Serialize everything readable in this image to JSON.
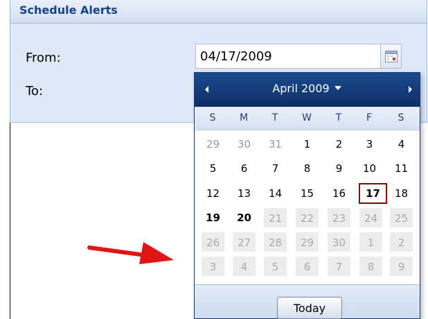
{
  "panel": {
    "title": "Schedule Alerts",
    "from_label": "From:",
    "to_label": "To:",
    "from_value": "04/17/2009"
  },
  "picker": {
    "month_label": "April 2009",
    "weekdays": [
      "S",
      "M",
      "T",
      "W",
      "T",
      "F",
      "S"
    ],
    "weeks": [
      [
        "29",
        "30",
        "31",
        "1",
        "2",
        "3",
        "4"
      ],
      [
        "5",
        "6",
        "7",
        "8",
        "9",
        "10",
        "11"
      ],
      [
        "12",
        "13",
        "14",
        "15",
        "16",
        "17",
        "18"
      ],
      [
        "19",
        "20",
        "21",
        "22",
        "23",
        "24",
        "25"
      ],
      [
        "26",
        "27",
        "28",
        "29",
        "30",
        "1",
        "2"
      ],
      [
        "3",
        "4",
        "5",
        "6",
        "7",
        "8",
        "9"
      ]
    ],
    "selected_day": "17",
    "today_button": "Today"
  },
  "icons": {
    "calendar_trigger": "calendar-icon",
    "prev_month": "chevron-left-icon",
    "next_month": "chevron-right-icon",
    "month_menu": "caret-down-icon",
    "annotation": "red-arrow-icon"
  },
  "colors": {
    "header_blue": "#0d2f67",
    "panel_title": "#15428b",
    "selected_border": "#8b0000",
    "arrow_red": "#e01515"
  }
}
